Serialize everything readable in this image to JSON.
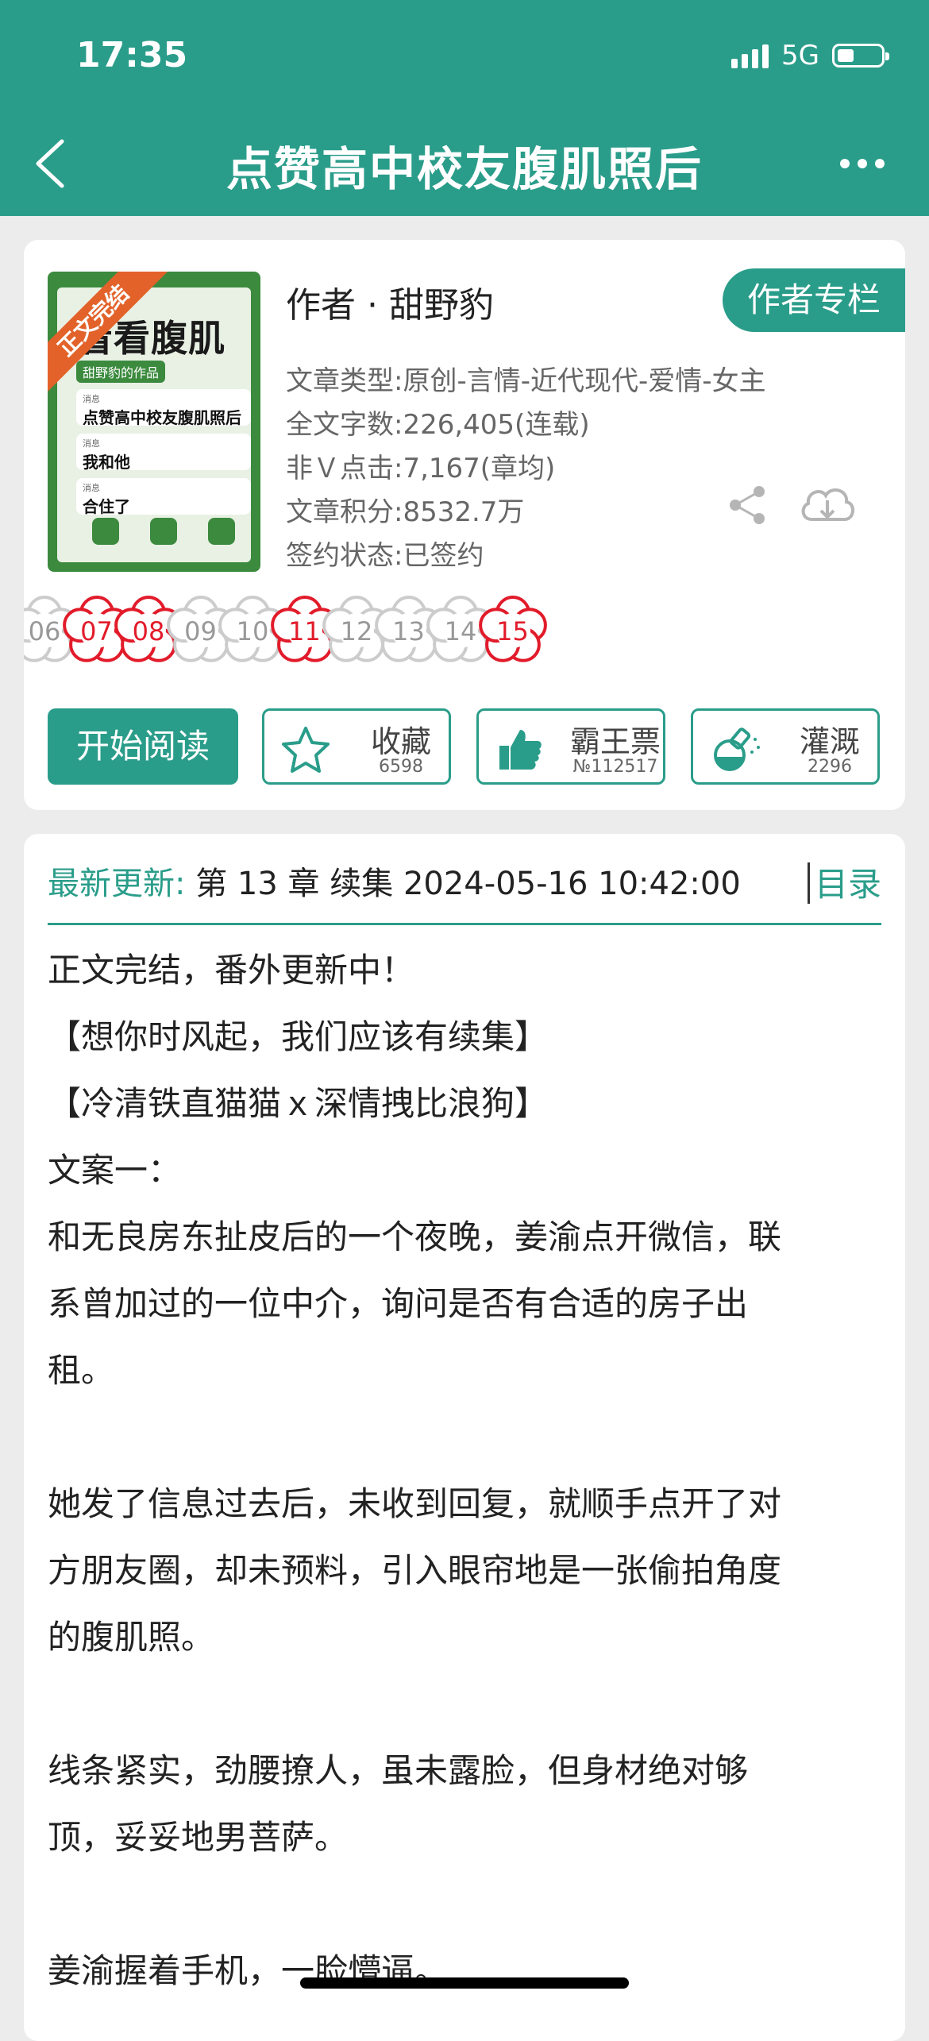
{
  "status": {
    "time": "17:35",
    "network": "5G"
  },
  "nav": {
    "title": "点赞高中校友腹肌照后"
  },
  "book": {
    "cover": {
      "ribbon": "正文完结",
      "title": "看看腹肌",
      "subtitle": "甜野豹的作品",
      "messages": [
        "点赞高中校友腹肌照后",
        "我和他",
        "合住了"
      ],
      "message_tag": "消息"
    },
    "author": "作者 · 甜野豹",
    "author_column_label": "作者专栏",
    "meta": [
      "文章类型:原创-言情-近代现代-爱情-女主",
      "全文字数:226,405(连载)",
      "非Ｖ点击:7,167(章均)",
      "文章积分:8532.7万",
      "签约状态:已签约"
    ]
  },
  "flowers": [
    {
      "num": "06",
      "active": false
    },
    {
      "num": "07",
      "active": true
    },
    {
      "num": "08",
      "active": true
    },
    {
      "num": "09",
      "active": false
    },
    {
      "num": "10",
      "active": false
    },
    {
      "num": "11",
      "active": true
    },
    {
      "num": "12",
      "active": false
    },
    {
      "num": "13",
      "active": false
    },
    {
      "num": "14",
      "active": false
    },
    {
      "num": "15",
      "active": true
    }
  ],
  "actions": {
    "read_label": "开始阅读",
    "collect": {
      "label": "收藏",
      "count": "6598"
    },
    "vote": {
      "label": "霸王票",
      "count": "№112517"
    },
    "nutrient": {
      "label": "灌溉",
      "count": "2296"
    }
  },
  "update": {
    "label": "最新更新:",
    "text": "第 13 章 续集 2024-05-16 10:42:00",
    "toc_label": "目录"
  },
  "description": [
    "正文完结，番外更新中！",
    "【想你时风起，我们应该有续集】",
    "【冷清铁直猫猫ｘ深情拽比浪狗】",
    "文案一：",
    "和无良房东扯皮后的一个夜晚，姜渝点开微信，联",
    "系曾加过的一位中介，询问是否有合适的房子出",
    "租。",
    "",
    "她发了信息过去后，未收到回复，就顺手点开了对",
    "方朋友圈，却未预料，引入眼帘地是一张偷拍角度",
    "的腹肌照。",
    "",
    "线条紧实，劲腰撩人，虽未露脸，但身材绝对够",
    "顶，妥妥地男菩萨。",
    "",
    "姜渝握着手机，一脸懵逼。"
  ],
  "colors": {
    "accent": "#2a9d8a",
    "flower_active": "#e21b2a",
    "flower_inactive": "#cccccc"
  }
}
